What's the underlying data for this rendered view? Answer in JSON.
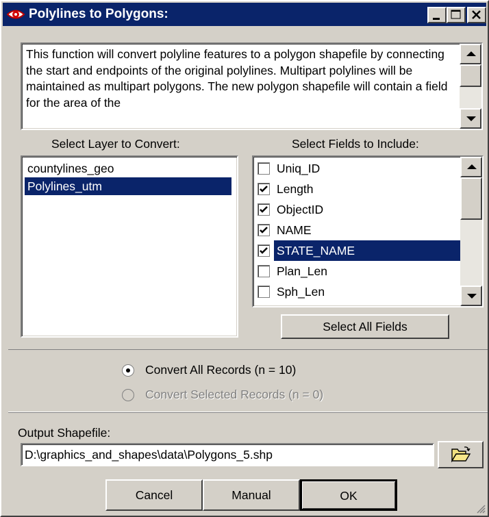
{
  "window": {
    "title": "Polylines to Polygons:",
    "minimize_label": "_",
    "maximize_label": "□",
    "close_label": "×"
  },
  "description": "This function will convert polyline features to a polygon shapefile by connecting the start and endpoints of the original polylines. Multipart polylines will be maintained as multipart polygons. The new polygon shapefile will contain a field for the area of the",
  "layers": {
    "label": "Select Layer to Convert:",
    "items": [
      {
        "label": "countylines_geo",
        "selected": false
      },
      {
        "label": "Polylines_utm",
        "selected": true
      }
    ]
  },
  "fields": {
    "label": "Select Fields to Include:",
    "items": [
      {
        "label": "Uniq_ID",
        "checked": false,
        "selected": false
      },
      {
        "label": "Length",
        "checked": true,
        "selected": false
      },
      {
        "label": "ObjectID",
        "checked": true,
        "selected": false
      },
      {
        "label": "NAME",
        "checked": true,
        "selected": false
      },
      {
        "label": "STATE_NAME",
        "checked": true,
        "selected": true
      },
      {
        "label": "Plan_Len",
        "checked": false,
        "selected": false
      },
      {
        "label": "Sph_Len",
        "checked": false,
        "selected": false
      }
    ],
    "select_all_label": "Select All Fields"
  },
  "records": {
    "all_label": "Convert All Records (n = 10)",
    "all_selected": true,
    "selected_label": "Convert Selected Records (n = 0)",
    "selected_enabled": false
  },
  "output": {
    "label": "Output Shapefile:",
    "value": "D:\\graphics_and_shapes\\data\\Polygons_5.shp"
  },
  "buttons": {
    "cancel": "Cancel",
    "manual": "Manual",
    "ok": "OK"
  },
  "colors": {
    "titlebar": "#0a246a",
    "face": "#d4d0c8",
    "selection": "#0a246a"
  }
}
